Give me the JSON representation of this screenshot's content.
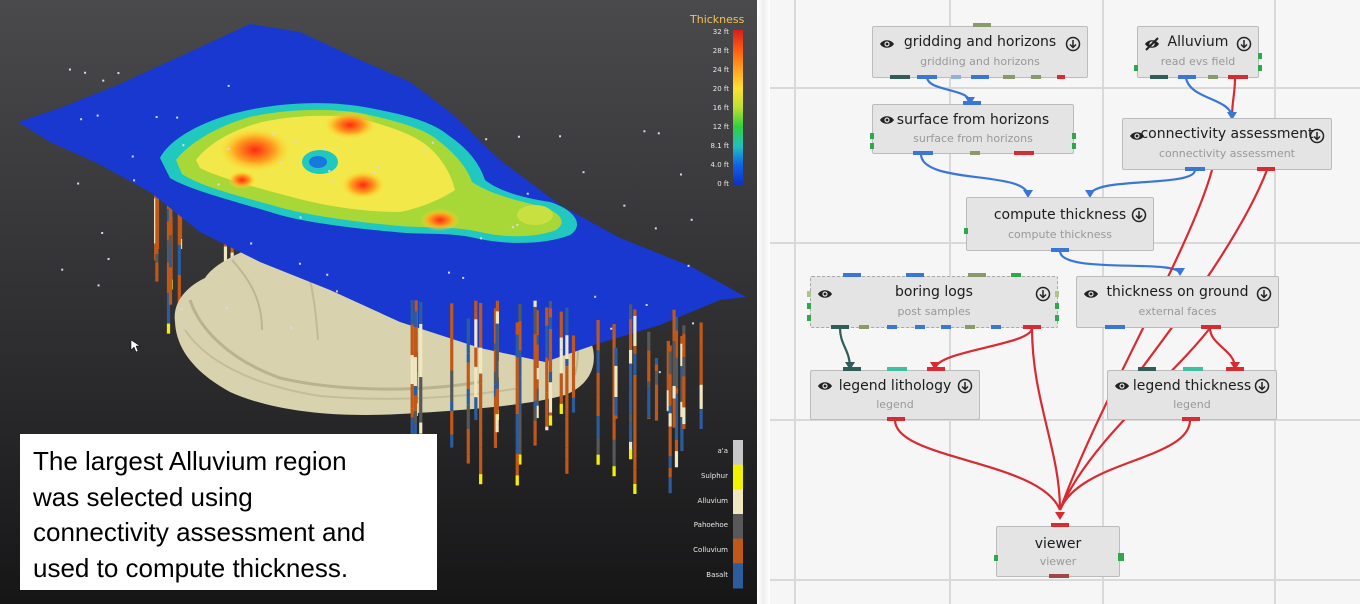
{
  "caption": {
    "lines": [
      "The largest Alluvium region",
      "was selected using",
      "connectivity assessment and",
      "used to compute thickness."
    ]
  },
  "colorbar": {
    "title": "Thickness",
    "ticks": [
      "32 ft",
      "28 ft",
      "24 ft",
      "20 ft",
      "16 ft",
      "12 ft",
      "8.1 ft",
      "4.0 ft",
      "0 ft"
    ],
    "gradient_colors": [
      "#d42020",
      "#ff5a10",
      "#ffa020",
      "#ffe030",
      "#bde030",
      "#30d040",
      "#20c0c0",
      "#1060e8",
      "#1030c0"
    ]
  },
  "materials": [
    {
      "label": "a'a",
      "color": "#c8c8c8"
    },
    {
      "label": "Sulphur",
      "color": "#f2f200"
    },
    {
      "label": "Alluvium",
      "color": "#efe7c0"
    },
    {
      "label": "Pahoehoe",
      "color": "#585858"
    },
    {
      "label": "Colluvium",
      "color": "#c0581a"
    },
    {
      "label": "Basalt",
      "color": "#2c5c9c"
    }
  ],
  "nodes": {
    "gridding": {
      "title": "gridding and horizons",
      "subtitle": "gridding and horizons",
      "icon_left": "eye-icon",
      "icon_right": "download-icon"
    },
    "alluvium": {
      "title": "Alluvium",
      "subtitle": "read evs field",
      "icon_left": "eye-hidden-icon",
      "icon_right": "download-icon"
    },
    "surface": {
      "title": "surface from horizons",
      "subtitle": "surface from horizons",
      "icon_left": "eye-icon"
    },
    "connectivity": {
      "title": "connectivity assessment",
      "subtitle": "connectivity assessment",
      "icon_left": "eye-icon",
      "icon_right": "download-icon"
    },
    "compute": {
      "title": "compute thickness",
      "subtitle": "compute thickness",
      "icon_right": "download-icon"
    },
    "boring": {
      "title": "boring logs",
      "subtitle": "post samples",
      "icon_left": "eye-icon",
      "icon_right": "download-icon"
    },
    "thickness_ground": {
      "title": "thickness on ground",
      "subtitle": "external faces",
      "icon_left": "eye-icon",
      "icon_right": "download-icon"
    },
    "legend_lith": {
      "title": "legend lithology",
      "subtitle": "legend",
      "icon_left": "eye-icon",
      "icon_right": "download-icon"
    },
    "legend_thick": {
      "title": "legend thickness",
      "subtitle": "legend",
      "icon_left": "eye-icon",
      "icon_right": "download-icon"
    },
    "viewer": {
      "title": "viewer",
      "subtitle": "viewer"
    }
  },
  "colors": {
    "connector_blue": "#3a76d8",
    "connector_red": "#d82a30",
    "connector_teal": "#2f5e58",
    "port_green": "#2ea84a",
    "canvas_grid": "#d9d9d9"
  }
}
